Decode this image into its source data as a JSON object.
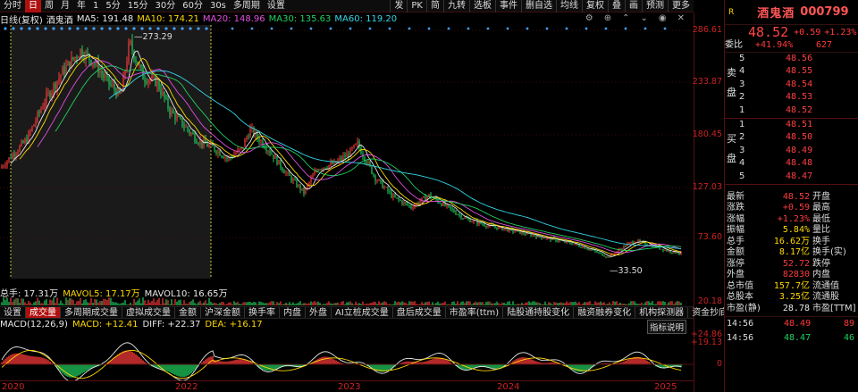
{
  "toolbar": {
    "items": [
      "分时",
      "日",
      "周",
      "月",
      "年",
      "1",
      "5分",
      "15分",
      "30分",
      "60分",
      "30s",
      "多周期",
      "设置"
    ],
    "active_index": 1,
    "right_items": [
      "发",
      "PK",
      "简",
      "九转",
      "选板",
      "事件",
      "删自选",
      "均线",
      "复权",
      "叠",
      "画",
      "预测",
      "更多"
    ]
  },
  "ma_line": {
    "mode": "日线(复权)",
    "name": "酒鬼酒",
    "ma5": "MA5: 191.48",
    "ma10": "MA10: 174.21",
    "ma20": "MA20: 148.96",
    "ma30": "MA30: 135.63",
    "ma60": "MA60: 119.20"
  },
  "yaxis": {
    "labels": [
      "286.61",
      "233.87",
      "180.45",
      "127.03",
      "73.60",
      "20.18"
    ]
  },
  "annotations": {
    "high": "273.29",
    "low": "33.50"
  },
  "volume": {
    "label": "总手: 17.31万",
    "mavol5": "MAVOL5: 17.17万",
    "mavol10": "MAVOL10: 16.65万"
  },
  "tabs": [
    "设置",
    "成交量",
    "多周期成交量",
    "虚拟成交量",
    "金额",
    "沪深金额",
    "换手率",
    "内盘",
    "外盘",
    "AI立桩成交量",
    "盘后成交量",
    "市盈率(ttm)",
    "陆股通持股变化",
    "融资融券变化",
    "机构探测器",
    "资金抄底"
  ],
  "tab_active": 1,
  "macd": {
    "title": "MACD(12,26,9)",
    "macd": "MACD: +12.41",
    "diff": "DIFF: +22.37",
    "dea": "DEA: +16.17",
    "explain": "指标说明",
    "axis": [
      "+24.86",
      "+19.13",
      "0"
    ]
  },
  "xaxis": [
    "2020",
    "2022",
    "2023",
    "2024",
    "2025"
  ],
  "panel": {
    "name": "酒鬼酒",
    "code": "000799",
    "price": "48.52",
    "change": "+0.59",
    "pct": "+1.23%",
    "weibi_label": "委比",
    "weibi": "+41.94%",
    "weicha": "627",
    "sell_side": "卖盘",
    "buy_side": "买盘",
    "asks": [
      {
        "idx": "5",
        "price": "48.56"
      },
      {
        "idx": "4",
        "price": "48.55"
      },
      {
        "idx": "3",
        "price": "48.54"
      },
      {
        "idx": "2",
        "price": "48.53"
      },
      {
        "idx": "1",
        "price": "48.52"
      }
    ],
    "bids": [
      {
        "idx": "1",
        "price": "48.51"
      },
      {
        "idx": "2",
        "price": "48.50"
      },
      {
        "idx": "3",
        "price": "48.49"
      },
      {
        "idx": "4",
        "price": "48.48"
      },
      {
        "idx": "5",
        "price": "48.47"
      }
    ],
    "stats": [
      {
        "k": "最新",
        "v": "48.52",
        "k2": "开盘",
        "c": "red"
      },
      {
        "k": "涨跌",
        "v": "+0.59",
        "k2": "最高",
        "c": "red"
      },
      {
        "k": "涨幅",
        "v": "+1.23%",
        "k2": "最低",
        "c": "red"
      },
      {
        "k": "振幅",
        "v": "5.84%",
        "k2": "量比",
        "c": "yel"
      },
      {
        "k": "总手",
        "v": "16.62万",
        "k2": "换手",
        "c": "yel"
      },
      {
        "k": "金额",
        "v": "8.17亿",
        "k2": "换手(实)",
        "c": "yel"
      },
      {
        "k": "涨停",
        "v": "52.72",
        "k2": "跌停",
        "c": "red"
      },
      {
        "k": "外盘",
        "v": "82830",
        "k2": "内盘",
        "c": "red"
      },
      {
        "k": "总市值",
        "v": "157.7亿",
        "k2": "流通值",
        "c": "yel"
      },
      {
        "k": "总股本",
        "v": "3.25亿",
        "k2": "流通股",
        "c": "yel"
      },
      {
        "k": "市盈(静)",
        "v": "28.78",
        "k2": "市盈[TTM]",
        "c": "wht"
      }
    ],
    "ticks": [
      {
        "t": "14:56",
        "p": "48.49",
        "q": "89",
        "c": "red"
      },
      {
        "t": "14:56",
        "p": "48.47",
        "q": "46",
        "c": "grn"
      }
    ]
  },
  "colors": {
    "up": "#ff3b3b",
    "down": "#20d060",
    "accent": "#b01010"
  }
}
